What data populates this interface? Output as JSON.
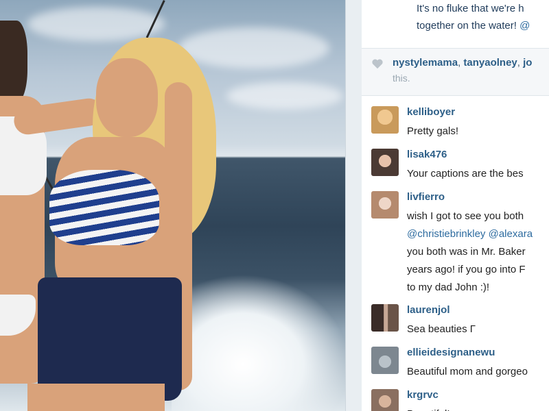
{
  "caption": {
    "line1": "It's no fluke that we're h",
    "line2_text": "together on the water! ",
    "line2_mention": "@"
  },
  "likes": {
    "likers": [
      "nystylemama",
      "tanyaolney",
      "jo"
    ],
    "separator": ",",
    "suffix": "this."
  },
  "comments": [
    {
      "user": "kelliboyer",
      "lines": [
        "Pretty gals!"
      ],
      "avatar_color": "#c99a5b"
    },
    {
      "user": "lisak476",
      "lines": [
        "Your captions are the bes"
      ],
      "avatar_color": "#4b3a34"
    },
    {
      "user": "livfierro",
      "lines": [
        [
          "wish I got to see you both"
        ],
        [
          "@christiebrinkley",
          " ",
          "@alexara"
        ],
        [
          "you both was in Mr. Baker"
        ],
        [
          "years ago! if you go into F"
        ],
        [
          "to my dad John :)!"
        ]
      ],
      "avatar_color": "#b58a6e"
    },
    {
      "user": "laurenjol",
      "lines": [
        "Sea beauties Γ"
      ],
      "avatar_color": "#6a5448"
    },
    {
      "user": "ellieidesignanewu",
      "lines": [
        "Beautiful mom and gorgeo"
      ],
      "avatar_color": "#7d8790"
    },
    {
      "user": "krgrvc",
      "lines": [
        "Beautiful!"
      ],
      "avatar_color": "#8a6f60"
    }
  ],
  "colors": {
    "username": "#2d5f88",
    "mention": "#2d6b9f",
    "text": "#222222",
    "heart": "#bcc4cb"
  },
  "icons": {
    "like": "heart-icon"
  }
}
